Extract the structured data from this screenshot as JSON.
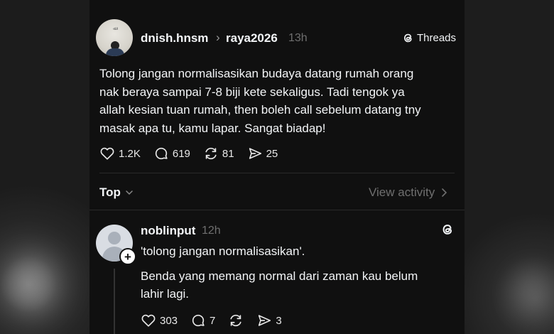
{
  "post": {
    "username": "dnish.hnsm",
    "reply_to": "raya2026",
    "time": "13h",
    "app_label": "Threads",
    "text": "Tolong jangan normalisasikan budaya datang rumah orang\nnak beraya sampai 7-8 biji kete sekaligus. Tadi tengok ya\nallah kesian tuan rumah, then boleh call sebelum datang tny\nmasak apa tu, kamu lapar. Sangat biadap!",
    "likes": "1.2K",
    "comments": "619",
    "reposts": "81",
    "shares": "25"
  },
  "sort": {
    "label": "Top",
    "view_activity": "View activity"
  },
  "reply": {
    "username": "noblinput",
    "time": "12h",
    "text_1": "'tolong jangan normalisasikan'.",
    "text_2": "Benda yang memang normal dari zaman kau belum\nlahir lagi.",
    "likes": "303",
    "comments": "7",
    "shares": "3"
  },
  "colors": {
    "panel_bg": "#101010",
    "text": "#f3f5f7",
    "muted": "#6f6f6f",
    "divider": "#2a2a2a"
  },
  "icons": [
    "heart-icon",
    "comment-icon",
    "repost-icon",
    "share-icon",
    "threads-logo-icon",
    "chevron-down-icon",
    "chevron-right-icon",
    "plus-icon"
  ]
}
